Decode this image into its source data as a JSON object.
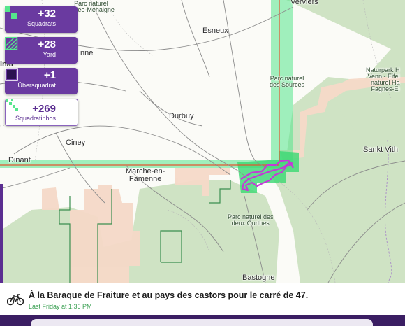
{
  "map": {
    "places": [
      {
        "id": "parc-top",
        "text": "Parc naturel\nVallée-Mehaigne"
      },
      {
        "id": "verviers",
        "text": "Verviers"
      },
      {
        "id": "esneux",
        "text": "Esneux"
      },
      {
        "id": "anne",
        "text": "nne"
      },
      {
        "id": "parc-sources",
        "text": "Parc naturel\ndes Sources"
      },
      {
        "id": "naturpark",
        "text": "Naturpark H\nVenn - Eifel\nnaturel Ha\nFagnes-Ei"
      },
      {
        "id": "durbuy",
        "text": "Durbuy"
      },
      {
        "id": "ciney",
        "text": "Ciney"
      },
      {
        "id": "sankt-vith",
        "text": "Sankt Vith"
      },
      {
        "id": "dinant",
        "text": "Dinant"
      },
      {
        "id": "marche",
        "text": "Marche-en-\nFamenne"
      },
      {
        "id": "parc-ourthes",
        "text": "Parc naturel des\ndeux Ourthes"
      },
      {
        "id": "bastogne",
        "text": "Bastogne"
      },
      {
        "id": "partial-left",
        "text": "inal"
      }
    ]
  },
  "stats": [
    {
      "id": "squadrats",
      "value": "+32",
      "label": "Squadrats",
      "icon": "squadrats-icon",
      "style": "purple"
    },
    {
      "id": "yard",
      "value": "+28",
      "label": "Yard",
      "icon": "yard-icon",
      "style": "purple"
    },
    {
      "id": "ubersquadrat",
      "value": "+1",
      "label": "Übersquadrat",
      "icon": "ubersquadrat-icon",
      "style": "purple"
    },
    {
      "id": "squadratinhos",
      "value": "+269",
      "label": "Squadratinhos",
      "icon": "squadratinhos-icon",
      "style": "white"
    }
  ],
  "activity": {
    "title": "À la Baraque de Fraiture et au pays des castors pour le carré de 47.",
    "date": "Last Friday at 1:36 PM",
    "icon": "bicycle-icon"
  },
  "colors": {
    "brand": "#6a3aa0",
    "new_squadrat": "#55e68c",
    "visited_overlay": "#f5d9c8",
    "forest": "#cfe3c4",
    "route": "#c43ad6",
    "grid_line": "#e2552f"
  }
}
